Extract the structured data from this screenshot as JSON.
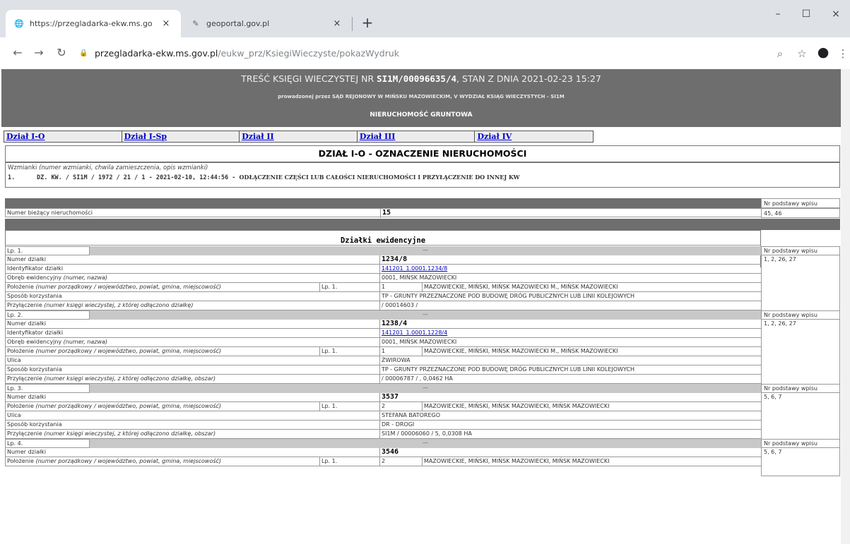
{
  "browser": {
    "tabs": [
      {
        "title": "https://przegladarka-ekw.ms.go",
        "close": "×"
      },
      {
        "title": "geoportal.gov.pl",
        "close": "×"
      }
    ],
    "new_tab": "+",
    "address_host": "przegladarka-ekw.ms.gov.pl",
    "address_path": "/eukw_prz/KsiegiWieczyste/pokazWydruk",
    "window_controls": [
      "–",
      "☐",
      "×"
    ]
  },
  "header": {
    "line1_prefix": "TREŚĆ KSIĘGI WIECZYSTEJ NR ",
    "kw_number": "SI1M/00096635/4",
    "line1_suffix": ", STAN Z DNIA 2021-02-23 15:27",
    "line2": "prowadzonej przez SĄD REJONOWY W MIŃSKU MAZOWIECKIM, V WYDZIAŁ KSIĄG WIECZYSTYCH - SI1M",
    "line3": "NIERUCHOMOŚĆ GRUNTOWA"
  },
  "nav_links": [
    "Dział I-O",
    "Dział I-Sp",
    "Dział II",
    "Dział III",
    "Dział IV"
  ],
  "section_title": "DZIAŁ I-O - OZNACZENIE NIERUCHOMOŚCI",
  "wzmianki": {
    "label": "Wzmianki",
    "label_italic": " (numer wzmianki, chwila zamieszczenia, opis wzmianki)",
    "item_no": "1.",
    "item_ref": "DZ. KW. / SI1M / 1972 / 21 / 1 - 2021-02-10, 12:44:56 - ",
    "item_text": "ODŁĄCZENIE CZĘŚCI LUB CAŁOŚCI NIERUCHOMOŚCI I PRZYŁĄCZENIE DO INNEJ KW"
  },
  "nr_podstawy": "Nr podstawy wpisu",
  "biezacy": {
    "label": "Numer bieżący nieruchomości",
    "value": "15",
    "podstawa": "45, 46"
  },
  "dzialki_title": "Działki ewidencyjne",
  "dash": "—",
  "lp1": {
    "lp": "Lp. 1.",
    "numer_label": "Numer działki",
    "numer": "1234/8",
    "ident_label": "Identyfikator działki",
    "ident": "141201_1.0001.1234/8",
    "obreb_label": "Obręb ewidencyjny",
    "obreb_italic": " (numer, nazwa)",
    "obreb": "0001, MIŃSK MAZOWIECKI",
    "polozenie_label": "Położenie",
    "polozenie_italic": " (numer porządkowy / województwo, powiat, gmina, miejscowość)",
    "polozenie_lp": "Lp. 1.",
    "polozenie_nr": "1",
    "polozenie": "MAZOWIECKIE, MIŃSKI, MIŃSK MAZOWIECKI M., MIŃSK MAZOWIECKI",
    "sposob_label": "Sposób korzystania",
    "sposob": "TP - GRUNTY PRZEZNACZONE POD BUDOWĘ DRÓG PUBLICZNYCH LUB LINII KOLEJOWYCH",
    "przyl_label": "Przyłączenie",
    "przyl_italic": " (numer księgi wieczystej, z której odłączono działkę)",
    "przyl": "/ 00014603 /",
    "podstawa": "1, 2, 26, 27"
  },
  "lp2": {
    "lp": "Lp. 2.",
    "numer_label": "Numer działki",
    "numer": "1238/4",
    "ident_label": "Identyfikator działki",
    "ident": "141201_1.0001.1228/4",
    "obreb_label": "Obręb ewidencyjny",
    "obreb_italic": " (numer, nazwa)",
    "obreb": "0001, MIŃSK MAZOWIECKI",
    "polozenie_label": "Położenie",
    "polozenie_italic": " (numer porządkowy / województwo, powiat, gmina, miejscowość)",
    "polozenie_lp": "Lp. 1.",
    "polozenie_nr": "1",
    "polozenie": "MAZOWIECKIE, MIŃSKI, MIŃSK MAZOWIECKI M., MIŃSK MAZOWIECKI",
    "ulica_label": "Ulica",
    "ulica": "ŻWIROWA",
    "sposob_label": "Sposób korzystania",
    "sposob": "TP - GRUNTY PRZEZNACZONE POD BUDOWĘ DRÓG PUBLICZNYCH LUB LINII KOLEJOWYCH",
    "przyl_label": "Przyłączenie",
    "przyl_italic": " (numer księgi wieczystej, z której odłączono działkę, obszar)",
    "przyl": "/ 00006787 / , 0,0462 HA",
    "podstawa": "1, 2, 26, 27"
  },
  "lp3": {
    "lp": "Lp. 3.",
    "numer_label": "Numer działki",
    "numer": "3537",
    "polozenie_label": "Położenie",
    "polozenie_italic": " (numer porządkowy / województwo, powiat, gmina, miejscowość)",
    "polozenie_lp": "Lp. 1.",
    "polozenie_nr": "2",
    "polozenie": "MAZOWIECKIE, MIŃSKI, MIŃSK MAZOWIECKI, MIŃSK MAZOWIECKI",
    "ulica_label": "Ulica",
    "ulica": "STEFANA BATOREGO",
    "sposob_label": "Sposób korzystania",
    "sposob": "DR - DROGI",
    "przyl_label": "Przyłączenie",
    "przyl_italic": " (numer księgi wieczystej, z której odłączono działkę, obszar)",
    "przyl": "SI1M / 00006060 / 5, 0,0308 HA",
    "podstawa": "5, 6, 7"
  },
  "lp4": {
    "lp": "Lp. 4.",
    "numer_label": "Numer działki",
    "numer": "3546",
    "polozenie_label": "Położenie",
    "polozenie_italic": " (numer porządkowy / województwo, powiat, gmina, miejscowość)",
    "polozenie_lp": "Lp. 1.",
    "polozenie_nr": "2",
    "polozenie": "MAZOWIECKIE, MIŃSKI, MIŃSK MAZOWIECKI, MIŃSK MAZOWIECKI",
    "podstawa": "5, 6, 7"
  }
}
